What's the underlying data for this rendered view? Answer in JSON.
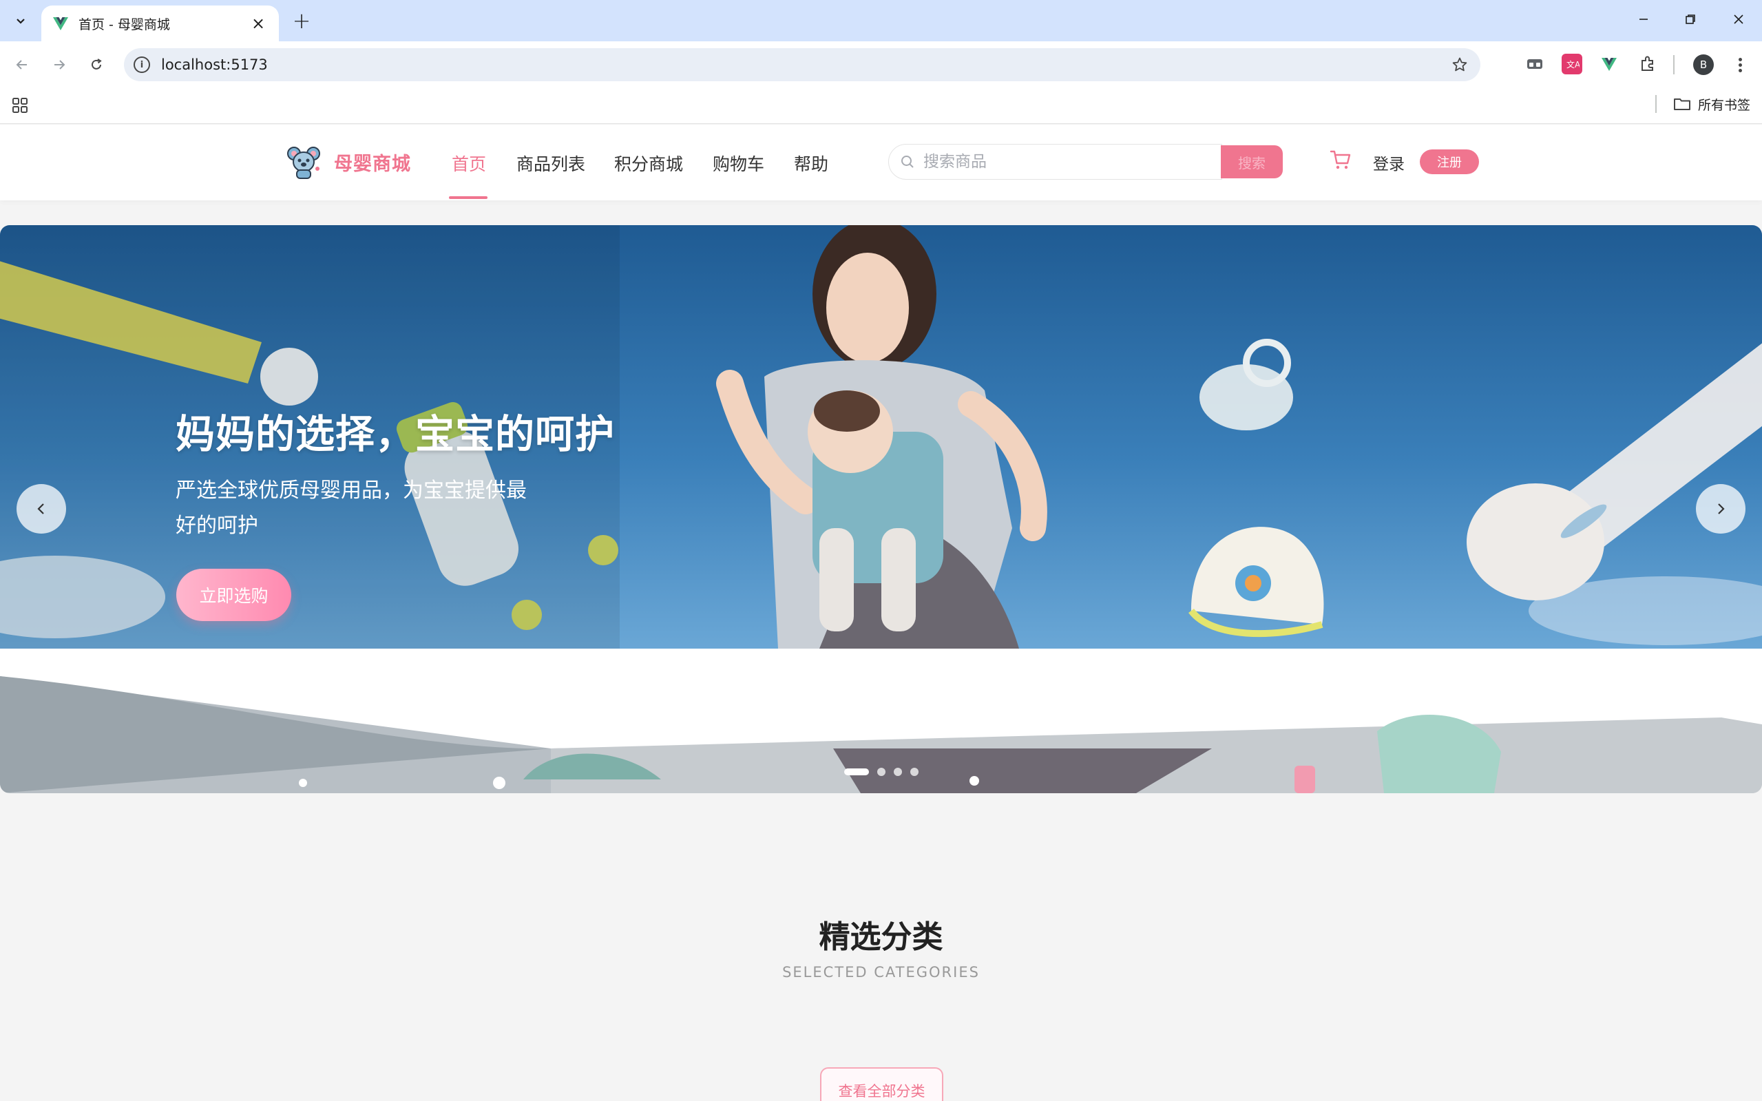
{
  "browser": {
    "tab_title": "首页 - 母婴商城",
    "url": "localhost:5173",
    "profile_initial": "B",
    "bookmarks_folder": "所有书签",
    "extensions": [
      "translate-extension-icon",
      "vue-devtools-icon",
      "puzzle-extensions-icon"
    ]
  },
  "header": {
    "logo_text": "母婴商城",
    "nav": [
      "首页",
      "商品列表",
      "积分商城",
      "购物车",
      "帮助"
    ],
    "active_nav": "首页",
    "search_placeholder": "搜索商品",
    "search_button": "搜索",
    "login": "登录",
    "register": "注册"
  },
  "hero": {
    "title": "妈妈的选择，宝宝的呵护",
    "subtitle": "严选全球优质母婴用品，为宝宝提供最好的呵护",
    "cta": "立即选购",
    "slide_count": 4,
    "active_slide": 1
  },
  "categories": {
    "title": "精选分类",
    "subtitle": "SELECTED CATEGORIES",
    "view_all": "查看全部分类"
  },
  "colors": {
    "brand": "#f0758f",
    "tabbar": "#d3e3fd",
    "page_bg": "#f4f4f4"
  }
}
